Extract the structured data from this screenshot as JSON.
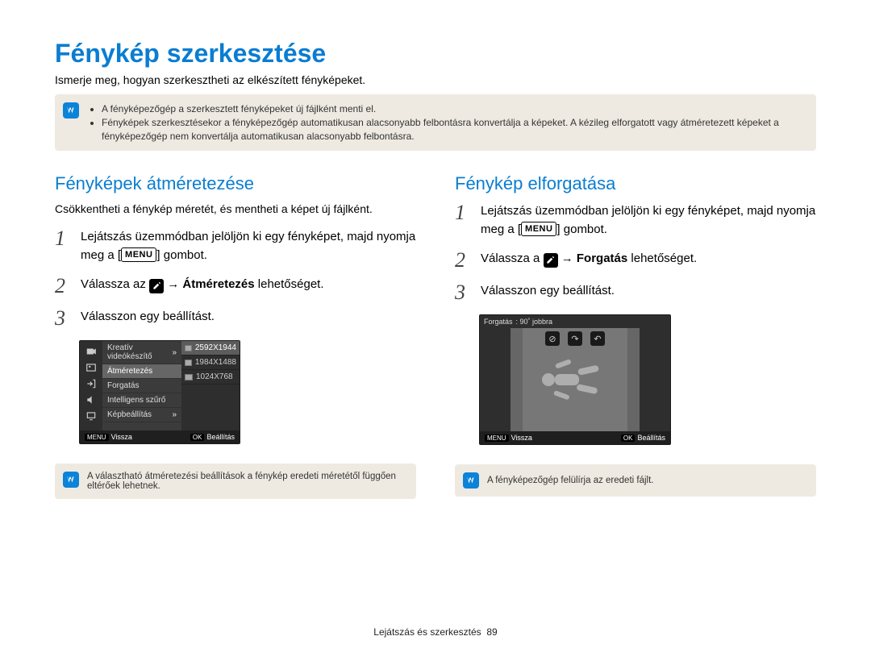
{
  "title": "Fénykép szerkesztése",
  "intro": "Ismerje meg, hogyan szerkesztheti az elkészített fényképeket.",
  "top_notes": [
    "A fényképezőgép a szerkesztett fényképeket új fájlként menti el.",
    "Fényképek szerkesztésekor a fényképezőgép automatikusan alacsonyabb felbontásra konvertálja a képeket. A kézileg elforgatott vagy átméretezett képeket a fényképezőgép nem konvertálja automatikusan alacsonyabb felbontásra."
  ],
  "left": {
    "heading": "Fényképek átméretezése",
    "sub": "Csökkentheti a fénykép méretét, és mentheti a képet új fájlként.",
    "steps": {
      "s1a": "Lejátszás üzemmódban jelöljön ki egy fényképet, majd nyomja meg a [",
      "s1b": "] gombot.",
      "s2a": "Válassza az ",
      "s2b": " → ",
      "s2bold": "Átméretezés",
      "s2c": " lehetőséget.",
      "s3": "Válasszon egy beállítást."
    },
    "lcd": {
      "menu": {
        "m0": "Kreatív videókészítő",
        "m1": "Átméretezés",
        "m2": "Forgatás",
        "m3": "Intelligens szűrő",
        "m4": "Képbeállítás"
      },
      "values": {
        "v0": "2592X1944",
        "v1": "1984X1488",
        "v2": "1024X768"
      },
      "back": "Vissza",
      "set": "Beállítás",
      "back_btn": "MENU",
      "ok_btn": "OK"
    },
    "note": "A választható átméretezési beállítások a fénykép eredeti méretétől függően eltérőek lehetnek."
  },
  "right": {
    "heading": "Fénykép elforgatása",
    "steps": {
      "s1a": "Lejátszás üzemmódban jelöljön ki egy fényképet, majd nyomja meg a [",
      "s1b": "] gombot.",
      "s2a": "Válassza a ",
      "s2b": " → ",
      "s2bold": "Forgatás",
      "s2c": " lehetőséget.",
      "s3": "Válasszon egy beállítást."
    },
    "lcd": {
      "label": "Forgatás",
      "value": ": 90˚ jobbra",
      "back": "Vissza",
      "set": "Beállítás",
      "back_btn": "MENU",
      "ok_btn": "OK"
    },
    "note": "A fényképezőgép felülírja az eredeti fájlt."
  },
  "menu_glyph": "MENU",
  "footer": {
    "section": "Lejátszás és szerkesztés",
    "page": "89"
  }
}
